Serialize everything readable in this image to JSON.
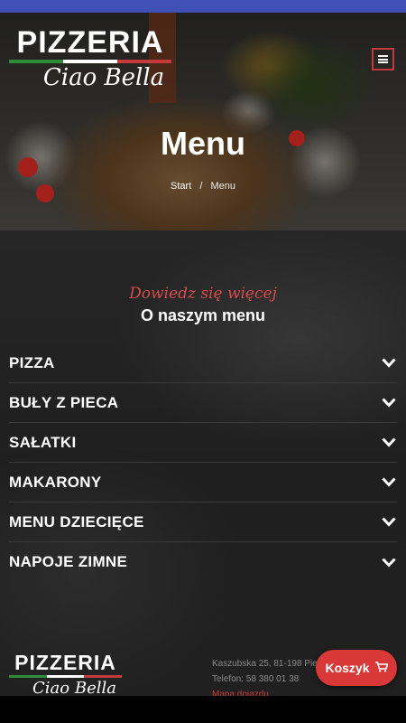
{
  "brand": {
    "name": "PIZZERIA",
    "tagline": "Ciao Bella",
    "flag_colors": [
      "#2e8b3a",
      "#ffffff",
      "#c43a3a"
    ]
  },
  "header": {
    "menu_icon": "hamburger-icon"
  },
  "hero": {
    "title": "Menu",
    "breadcrumb": {
      "home": "Start",
      "separator": "/",
      "current": "Menu"
    }
  },
  "intro": {
    "subtitle": "Dowiedz się więcej",
    "title": "O naszym menu"
  },
  "accordion": {
    "icon": "chevron-down-icon",
    "items": [
      {
        "label": "PIZZA"
      },
      {
        "label": "BUŁY Z PIECA"
      },
      {
        "label": "SAŁATKI"
      },
      {
        "label": "MAKARONY"
      },
      {
        "label": "MENU DZIECIĘCE"
      },
      {
        "label": "NAPOJE ZIMNE"
      }
    ]
  },
  "footer": {
    "address": "Kaszubska 25, 81-198 Pie",
    "phone": "Telefon: 58 380 01 38",
    "map_link": "Mapa dojazdu"
  },
  "cart": {
    "label": "Koszyk",
    "icon": "cart-icon"
  },
  "colors": {
    "accent": "#d83838",
    "status_bar": "#3f51b5"
  }
}
